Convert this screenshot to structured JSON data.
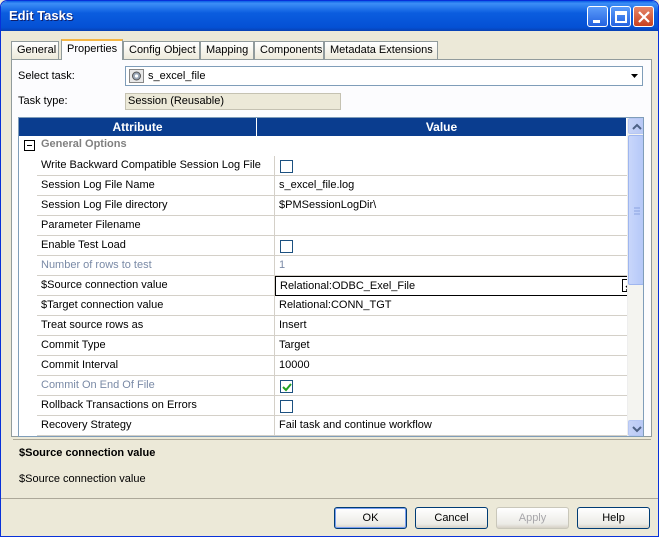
{
  "window": {
    "title": "Edit Tasks"
  },
  "tabs": [
    {
      "label": "General",
      "active": false
    },
    {
      "label": "Properties",
      "active": true
    },
    {
      "label": "Config Object",
      "active": false
    },
    {
      "label": "Mapping",
      "active": false
    },
    {
      "label": "Components",
      "active": false
    },
    {
      "label": "Metadata Extensions",
      "active": false
    }
  ],
  "select_task": {
    "label": "Select task:",
    "value": "s_excel_file",
    "icon": "session-icon"
  },
  "task_type": {
    "label": "Task type:",
    "value": "Session (Reusable)"
  },
  "grid": {
    "headers": {
      "attribute": "Attribute",
      "value": "Value"
    },
    "group": "General Options",
    "rows": [
      {
        "attr": "Write Backward Compatible Session Log File",
        "type": "checkbox",
        "checked": false
      },
      {
        "attr": "Session Log File Name",
        "value": "s_excel_file.log"
      },
      {
        "attr": "Session Log File directory",
        "value": "$PMSessionLogDir\\"
      },
      {
        "attr": "Parameter Filename",
        "value": ""
      },
      {
        "attr": "Enable Test Load",
        "type": "checkbox",
        "checked": false
      },
      {
        "attr": "Number of rows to test",
        "value": "1",
        "dim": true
      },
      {
        "attr": "$Source connection value",
        "value": "Relational:ODBC_Exel_File",
        "selected": true
      },
      {
        "attr": "$Target connection value",
        "value": "Relational:CONN_TGT"
      },
      {
        "attr": "Treat source rows as",
        "value": "Insert"
      },
      {
        "attr": "Commit Type",
        "value": "Target"
      },
      {
        "attr": "Commit Interval",
        "value": "10000"
      },
      {
        "attr": "Commit On End Of File",
        "type": "checkbox",
        "checked": true,
        "dim": true
      },
      {
        "attr": "Rollback Transactions on Errors",
        "type": "checkbox",
        "checked": false
      },
      {
        "attr": "Recovery Strategy",
        "value": "Fail task and continue workflow"
      }
    ]
  },
  "description": {
    "title": "$Source connection value",
    "text": "$Source connection value"
  },
  "buttons": {
    "ok": "OK",
    "cancel": "Cancel",
    "apply": "Apply",
    "help": "Help"
  }
}
